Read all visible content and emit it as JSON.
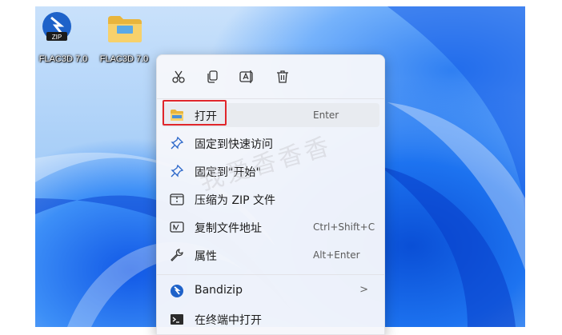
{
  "desktop": {
    "icons": [
      {
        "label": "FLAC3D 7.0",
        "type": "zip"
      },
      {
        "label": "FLAC3D 7.0",
        "type": "folder"
      }
    ],
    "zip_badge": "ZIP"
  },
  "context_menu": {
    "toolbar": [
      {
        "name": "cut"
      },
      {
        "name": "copy"
      },
      {
        "name": "rename"
      },
      {
        "name": "delete"
      }
    ],
    "items": [
      {
        "label": "打开",
        "shortcut": "Enter"
      },
      {
        "label": "固定到快速访问",
        "shortcut": ""
      },
      {
        "label": "固定到\"开始\"",
        "shortcut": ""
      },
      {
        "label": "压缩为 ZIP 文件",
        "shortcut": ""
      },
      {
        "label": "复制文件地址",
        "shortcut": "Ctrl+Shift+C"
      },
      {
        "label": "属性",
        "shortcut": "Alt+Enter"
      },
      {
        "label": "Bandizip",
        "shortcut": "",
        "submenu_arrow": ">"
      },
      {
        "label": "在终端中打开",
        "shortcut": ""
      }
    ]
  },
  "watermark": "我爱香香香"
}
